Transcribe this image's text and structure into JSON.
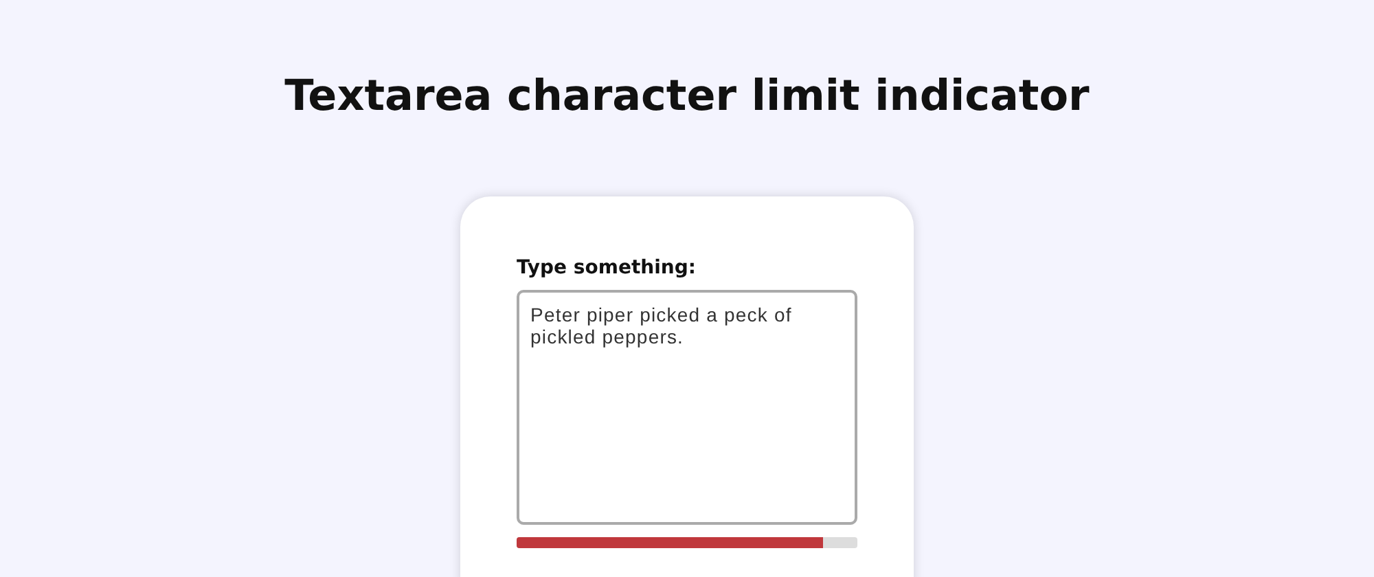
{
  "title": "Textarea character limit indicator",
  "form": {
    "label": "Type something:",
    "value": "Peter piper picked a peck of pickled peppers.",
    "limit_bar": {
      "level": 0.9
    }
  }
}
